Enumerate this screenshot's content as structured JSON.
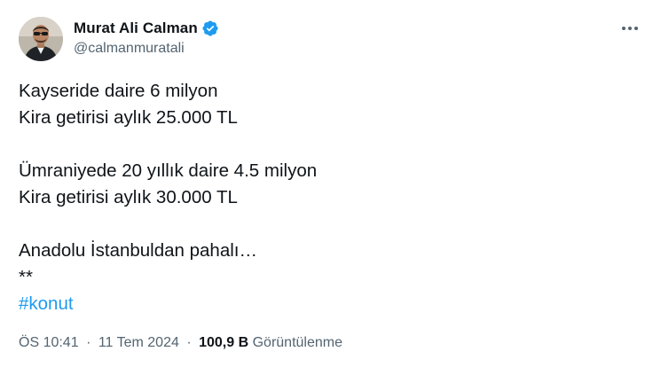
{
  "author": {
    "display_name": "Murat Ali Calman",
    "handle": "@calmanmuratali",
    "verified": true,
    "verified_color": "#1d9bf0"
  },
  "tweet": {
    "lines": [
      "Kayseride daire 6 milyon",
      "Kira getirisi aylık 25.000 TL",
      "",
      "Ümraniyede 20 yıllık daire 4.5 milyon",
      "Kira getirisi aylık 30.000 TL",
      "",
      "Anadolu İstanbuldan pahalı…",
      "**"
    ],
    "hashtag": "#konut",
    "hashtag_color": "#1d9bf0"
  },
  "meta": {
    "time": "ÖS 10:41",
    "separator": "·",
    "date": "11 Tem 2024",
    "views_count": "100,9 B",
    "views_label": "Görüntülenme"
  },
  "icons": {
    "verified": "verified-badge-icon",
    "more": "more-options-icon"
  }
}
